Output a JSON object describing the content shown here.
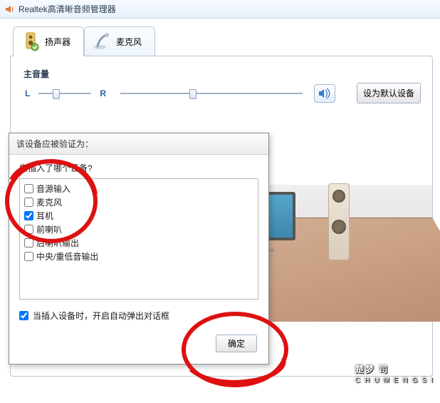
{
  "window": {
    "title": "Realtek高清晰音频管理器"
  },
  "tabs": {
    "speaker": {
      "label": "扬声器",
      "active": true
    },
    "mic": {
      "label": "麦克风",
      "active": false
    }
  },
  "volume": {
    "section_label": "主音量",
    "left_label": "L",
    "right_label": "R"
  },
  "buttons": {
    "set_default": "设为默认设备",
    "ok": "确定"
  },
  "dialog": {
    "title": "该设备应被验证为：",
    "prompt": "您插入了哪个设备?",
    "options": [
      {
        "label": "音源输入",
        "checked": false
      },
      {
        "label": "麦克风",
        "checked": false
      },
      {
        "label": "耳机",
        "checked": true
      },
      {
        "label": "前喇叭",
        "checked": false
      },
      {
        "label": "后喇叭输出",
        "checked": false
      },
      {
        "label": "中央/重低音输出",
        "checked": false
      }
    ],
    "auto_popup": {
      "label": "当插入设备时，开启自动弹出对话框",
      "checked": true
    }
  },
  "watermark": {
    "main": "楚梦 司",
    "sub": "CHUMENGSI"
  }
}
